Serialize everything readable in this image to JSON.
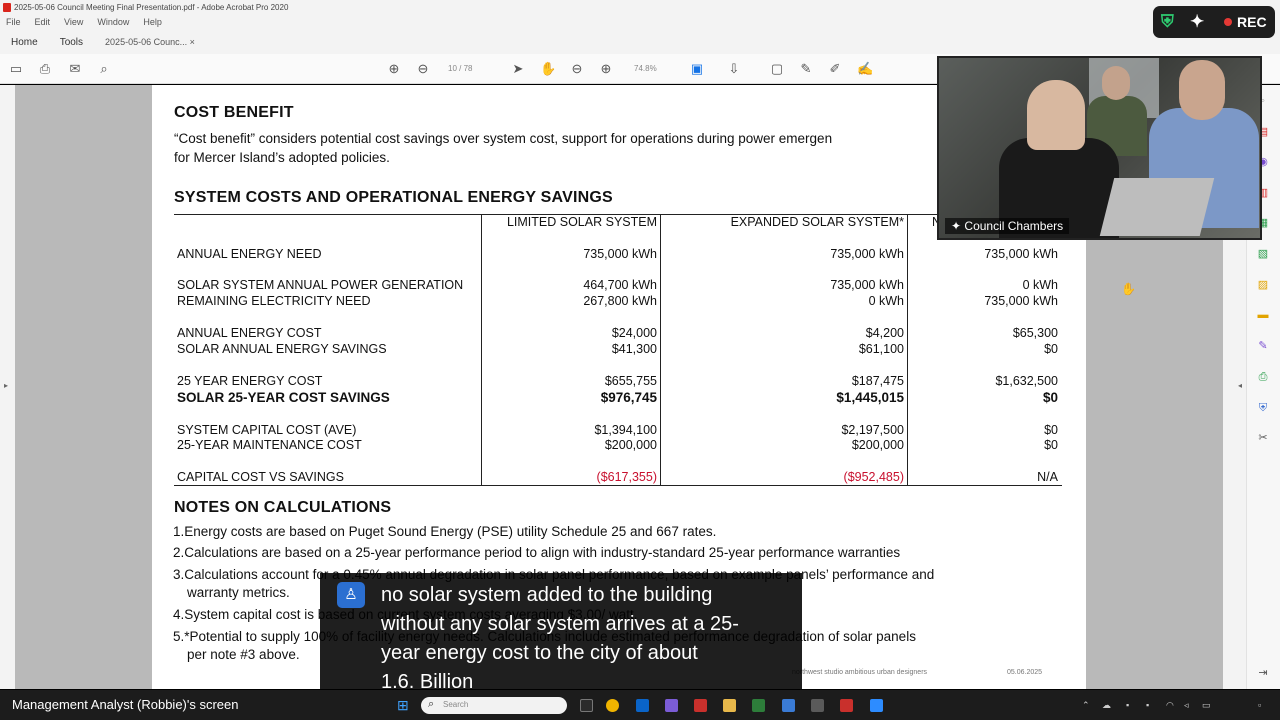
{
  "window": {
    "title": "2025-05-06 Council Meeting Final Presentation.pdf - Adobe Acrobat Pro 2020",
    "menu": [
      "File",
      "Edit",
      "View",
      "Window",
      "Help"
    ],
    "tabs": [
      {
        "label": "Home"
      },
      {
        "label": "Tools"
      },
      {
        "label": "2025-05-06 Counc... ×"
      }
    ]
  },
  "toolbar": {
    "page_indicator": "10 / 78",
    "zoom": "74.8%"
  },
  "page": {
    "cost_benefit": {
      "heading": "COST BENEFIT",
      "line1": "“Cost benefit” considers potential cost savings over system cost, support for operations during power emergen",
      "line2": "for Mercer Island’s adopted policies."
    },
    "table": {
      "heading": "SYSTEM COSTS AND OPERATIONAL ENERGY SAVINGS",
      "columns": [
        "LIMITED SOLAR SYSTEM",
        "EXPANDED SOLAR SYSTEM*",
        "N"
      ],
      "rows": [
        {
          "label": "ANNUAL ENERGY NEED",
          "v1": "735,000 kWh",
          "v2": "735,000 kWh",
          "v3": "735,000 kWh"
        },
        {
          "label": "SOLAR SYSTEM ANNUAL POWER GENERATION",
          "v1": "464,700 kWh",
          "v2": "735,000 kWh",
          "v3": "0 kWh"
        },
        {
          "label": "REMAINING ELECTRICITY NEED",
          "v1": "267,800 kWh",
          "v2": "0 kWh",
          "v3": "735,000 kWh"
        },
        {
          "label": "ANNUAL ENERGY COST",
          "v1": "$24,000",
          "v2": "$4,200",
          "v3": "$65,300"
        },
        {
          "label": "SOLAR ANNUAL ENERGY SAVINGS",
          "v1": "$41,300",
          "v2": "$61,100",
          "v3": "$0"
        },
        {
          "label": "25 YEAR ENERGY COST",
          "v1": "$655,755",
          "v2": "$187,475",
          "v3": "$1,632,500"
        },
        {
          "label": "SOLAR 25-YEAR COST SAVINGS",
          "v1": "$976,745",
          "v2": "$1,445,015",
          "v3": "$0"
        },
        {
          "label": "SYSTEM CAPITAL COST (AVE)",
          "v1": "$1,394,100",
          "v2": "$2,197,500",
          "v3": "$0"
        },
        {
          "label": "25-YEAR MAINTENANCE COST",
          "v1": "$200,000",
          "v2": "$200,000",
          "v3": "$0"
        },
        {
          "label": "CAPITAL COST VS SAVINGS",
          "v1": "($617,355)",
          "v2": "($952,485)",
          "v3": "N/A"
        }
      ]
    },
    "notes": {
      "heading": "NOTES ON CALCULATIONS",
      "items": [
        "1.Energy costs are based on Puget Sound Energy (PSE) utility Schedule 25 and 667 rates.",
        "2.Calculations are based on a 25-year performance period to align with industry-standard 25-year performance warranties",
        "3.Calculations account for a 0.45% annual degradation in solar panel performance, based on example panels’ performance and",
        "warranty metrics.",
        "4.System capital cost is based on current system costs averaging $3.00/ watt.",
        "5.*Potential to supply 100% of facility energy needs. Calculations include estimated performance degradation of solar panels",
        "per note #3 above."
      ]
    },
    "footer": {
      "firm": "northwest studio  ambitious urban designers",
      "date": "05.06.2025"
    }
  },
  "video": {
    "label": "Council Chambers"
  },
  "recording": {
    "label": "REC"
  },
  "caption": {
    "lines": [
      "no solar system added to the building",
      "without any solar system arrives at a 25-",
      "year energy cost to the city of about",
      "1.6. Billion"
    ]
  },
  "taskbar": {
    "share_label": "Management Analyst (Robbie)'s screen",
    "search_placeholder": "Search"
  },
  "colors": {
    "negative": "#c8102e",
    "rec_dot": "#e53935",
    "caption_icon": "#2b6fd1"
  }
}
